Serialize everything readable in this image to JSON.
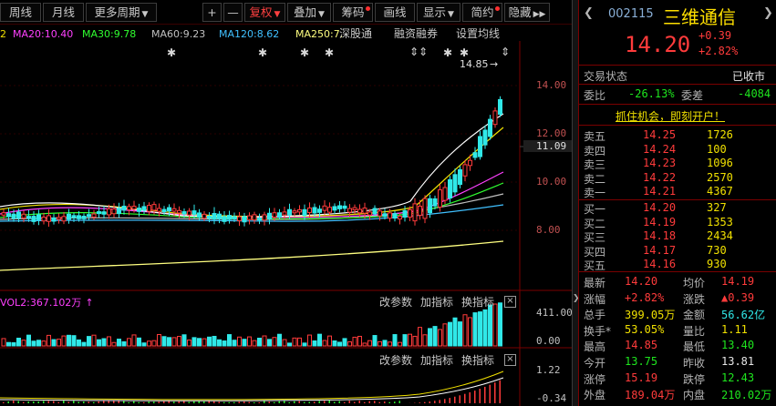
{
  "toolbar": {
    "weekly": "周线",
    "monthly": "月线",
    "more_periods": "更多周期",
    "plus": "+",
    "minus": "—",
    "fq": "复权",
    "overlay": "叠加",
    "chips": "筹码",
    "draw": "画线",
    "display": "显示",
    "simple": "简约",
    "hide": "隐藏"
  },
  "legend": {
    "ma10_partial": "2",
    "ma20": "MA20:10.40",
    "ma30": "MA30:9.78",
    "ma60": "MA60:9.23",
    "ma120": "MA120:8.62",
    "ma250": "MA250:7.",
    "sgt": "深股通",
    "rzrq": "融资融券",
    "set_ma": "设置均线"
  },
  "price_axis": {
    "t14": "14.00",
    "t12": "12.00",
    "t11": "11.09",
    "t10": "10.00",
    "t8": "8.00",
    "high_label": "14.85"
  },
  "volume_panel": {
    "vol_label": "VOL2:367.102万",
    "change_params": "改参数",
    "add_indicator": "加指标",
    "switch_indicator": "换指标",
    "close": "×",
    "axis_top": "411.00",
    "axis_bottom": "0.00"
  },
  "macd_panel": {
    "change_params": "改参数",
    "add_indicator": "加指标",
    "switch_indicator": "换指标",
    "close": "×",
    "axis_top": "1.22",
    "axis_bottom": "-0.34"
  },
  "quote": {
    "code": "002115",
    "name": "三维通信",
    "price": "14.20",
    "change": "+0.39",
    "change_pct": "+2.82%",
    "status_label": "交易状态",
    "status_value": "已收市",
    "weibi_label": "委比",
    "weibi_value": "-26.13%",
    "weicha_label": "委差",
    "weicha_value": "-4084",
    "promo": "抓住机会，即刻开户！",
    "asks": [
      {
        "label": "卖五",
        "price": "14.25",
        "vol": "1726"
      },
      {
        "label": "卖四",
        "price": "14.24",
        "vol": "100"
      },
      {
        "label": "卖三",
        "price": "14.23",
        "vol": "1096"
      },
      {
        "label": "卖二",
        "price": "14.22",
        "vol": "2570"
      },
      {
        "label": "卖一",
        "price": "14.21",
        "vol": "4367"
      }
    ],
    "bids": [
      {
        "label": "买一",
        "price": "14.20",
        "vol": "327"
      },
      {
        "label": "买二",
        "price": "14.19",
        "vol": "1353"
      },
      {
        "label": "买三",
        "price": "14.18",
        "vol": "2434"
      },
      {
        "label": "买四",
        "price": "14.17",
        "vol": "730"
      },
      {
        "label": "买五",
        "price": "14.16",
        "vol": "930"
      }
    ],
    "stats": [
      {
        "l1": "最新",
        "v1": "14.20",
        "c1": "red",
        "l2": "均价",
        "v2": "14.19",
        "c2": "red"
      },
      {
        "l1": "涨幅",
        "v1": "+2.82%",
        "c1": "red",
        "l2": "涨跌",
        "v2": "▲0.39",
        "c2": "red"
      },
      {
        "l1": "总手",
        "v1": "399.05万",
        "c1": "yellow",
        "l2": "金额",
        "v2": "56.62亿",
        "c2": "cyan"
      },
      {
        "l1": "换手*",
        "v1": "53.05%",
        "c1": "yellow",
        "l2": "量比",
        "v2": "1.11",
        "c2": "yellow"
      },
      {
        "l1": "最高",
        "v1": "14.85",
        "c1": "red",
        "l2": "最低",
        "v2": "13.40",
        "c2": "green"
      },
      {
        "l1": "今开",
        "v1": "13.75",
        "c1": "green",
        "l2": "昨收",
        "v2": "13.81",
        "c2": "white"
      },
      {
        "l1": "涨停",
        "v1": "15.19",
        "c1": "red",
        "l2": "跌停",
        "v2": "12.43",
        "c2": "green"
      },
      {
        "l1": "外盘",
        "v1": "189.04万",
        "c1": "red",
        "l2": "内盘",
        "v2": "210.02万",
        "c2": "green"
      }
    ]
  },
  "colors": {
    "up": "#ff3b3b",
    "down": "#30e8e8",
    "ma5": "#ffffff",
    "ma10": "#f0e000",
    "ma20": "#ff40ff",
    "ma30": "#30ff30",
    "ma60": "#c0c0c0",
    "ma120": "#40c0ff",
    "ma250": "#ffff80"
  }
}
